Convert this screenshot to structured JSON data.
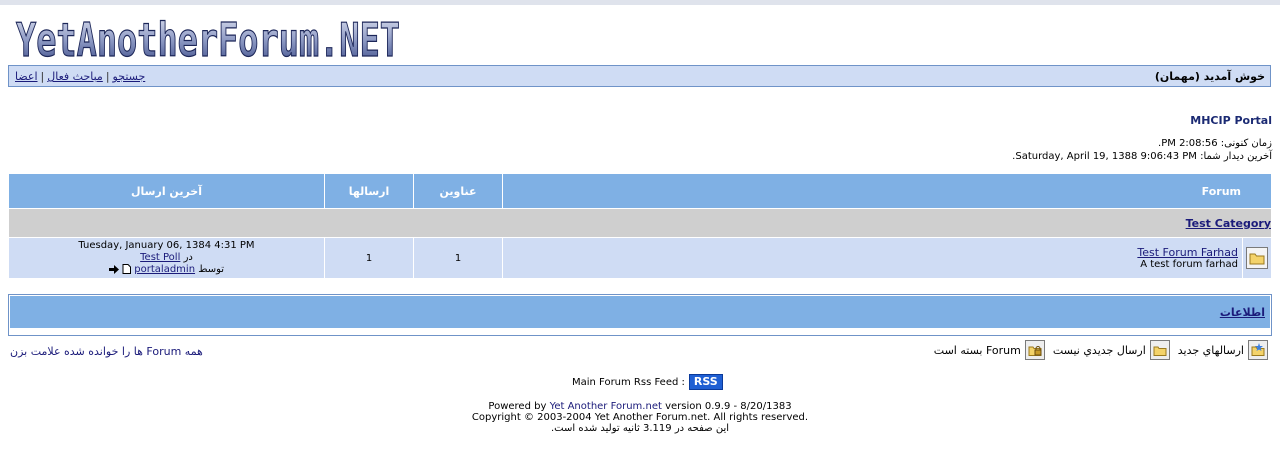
{
  "logo": {
    "text": "YetAnotherForum.NET"
  },
  "nav": {
    "welcome": "خوش آمدید (مهمان)",
    "links": [
      "جستجو",
      "مباحث فعال",
      "اعضا"
    ],
    "separator": "|"
  },
  "portal": {
    "title": "MHCIP Portal",
    "current_time": "زمان کنونی: 2:08:56 PM.",
    "last_visit": "آخرین دیدار شما: Saturday, April 19, 1388 9:06:43 PM."
  },
  "table": {
    "headers": {
      "forum": "Forum",
      "topics": "عناوین",
      "posts": "ارسالها",
      "last_post": "آخرین ارسال"
    },
    "category": "Test Category",
    "row": {
      "title": "Test Forum Farhad",
      "description": "A test forum farhad",
      "topics": "1",
      "posts": "1",
      "last_date": "Tuesday, January 06, 1384 4:31 PM",
      "in_label": "در",
      "in_topic": "Test Poll",
      "by_label": "توسط",
      "by_user": "portaladmin"
    }
  },
  "info": {
    "title": "اطلاعات"
  },
  "legend": {
    "new_posts": "ارسالهاي جديد",
    "no_new_posts": "ارسال جديدي نيست",
    "locked": "Forum بسته است",
    "mark_all_read": "همه Forum ها را خوانده شده علامت بزن"
  },
  "rss": {
    "label": "Main Forum Rss Feed :",
    "badge": "RSS"
  },
  "footer": {
    "powered_prefix": "Powered by",
    "powered_link": "Yet Another Forum.net",
    "version": "version 0.9.9 - 8/20/1383",
    "copyright": "Copyright © 2003-2004 Yet Another Forum.net. All rights reserved.",
    "generated": "این صفحه در 3.119 ثانیه تولید شده است."
  },
  "colors": {
    "header_blue": "#7fb0e4",
    "row_blue": "#cfdcf4",
    "border_blue": "#6f93c8",
    "link": "#1b1b7a",
    "category_gray": "#cfcfcf"
  }
}
